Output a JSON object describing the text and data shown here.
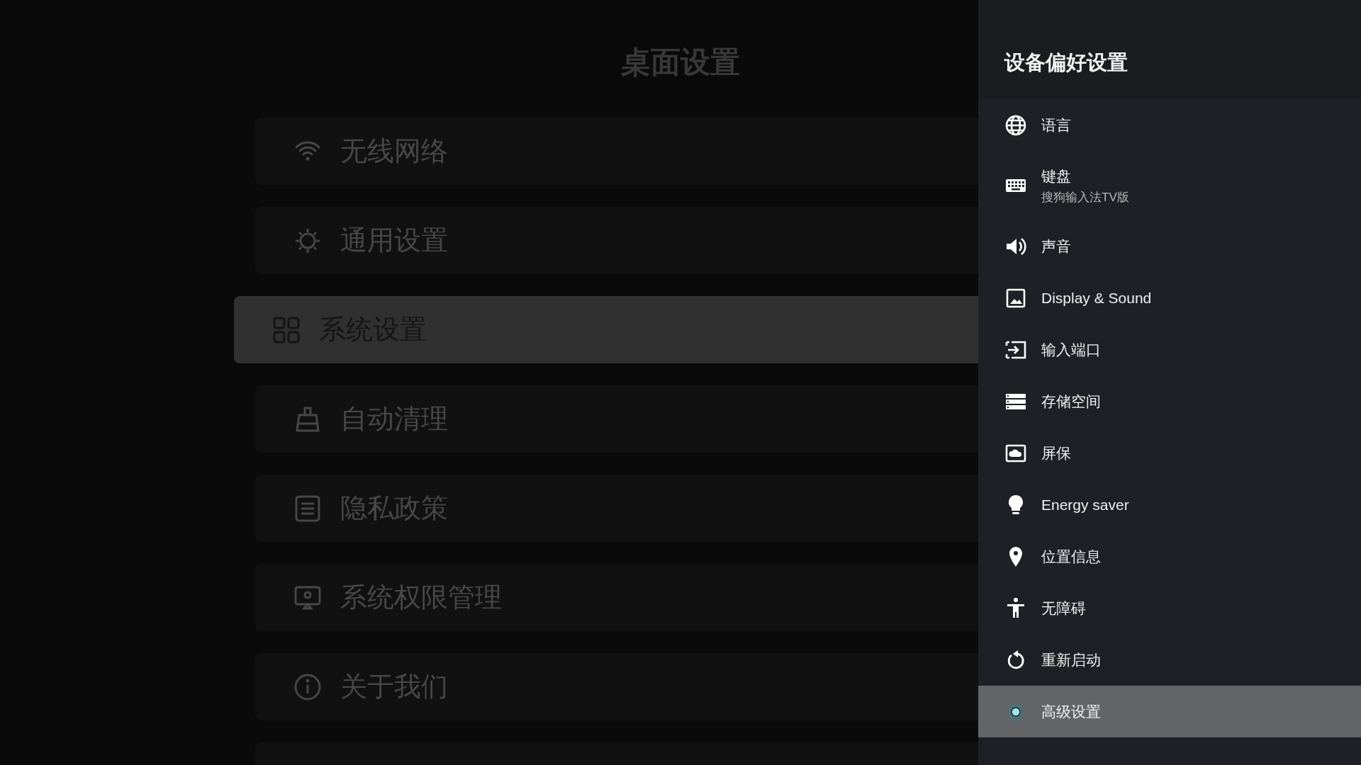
{
  "background": {
    "title": "桌面设置",
    "items": [
      {
        "label": "无线网络",
        "selected": false
      },
      {
        "label": "通用设置",
        "selected": false
      },
      {
        "label": "系统设置",
        "selected": true
      },
      {
        "label": "自动清理",
        "selected": false
      },
      {
        "label": "隐私政策",
        "selected": false
      },
      {
        "label": "系统权限管理",
        "selected": false
      },
      {
        "label": "关于我们",
        "selected": false
      }
    ]
  },
  "panel": {
    "title": "设备偏好设置",
    "items": [
      {
        "label": "语言",
        "selected": false
      },
      {
        "label": "键盘",
        "subtitle": "搜狗输入法TV版",
        "selected": false
      },
      {
        "label": "声音",
        "selected": false
      },
      {
        "label": "Display & Sound",
        "selected": false
      },
      {
        "label": "输入端口",
        "selected": false
      },
      {
        "label": "存储空间",
        "selected": false
      },
      {
        "label": "屏保",
        "selected": false
      },
      {
        "label": "Energy saver",
        "selected": false
      },
      {
        "label": "位置信息",
        "selected": false
      },
      {
        "label": "无障碍",
        "selected": false
      },
      {
        "label": "重新启动",
        "selected": false
      },
      {
        "label": "高级设置",
        "selected": true
      }
    ]
  }
}
